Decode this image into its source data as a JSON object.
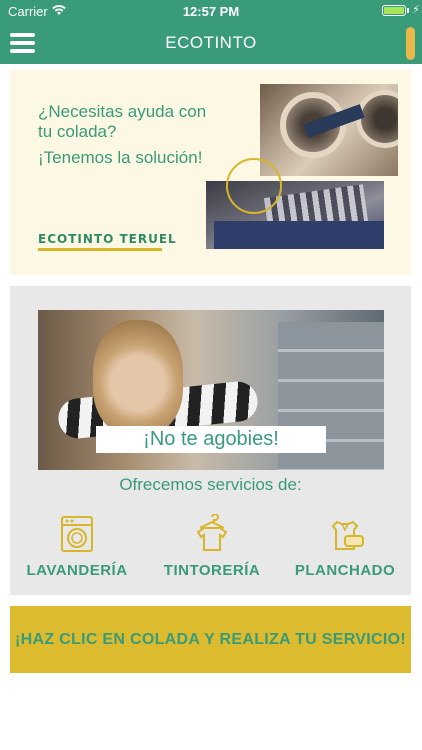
{
  "status_bar": {
    "carrier": "Carrier",
    "time": "12:57 PM",
    "battery_level": 1.0
  },
  "nav": {
    "title": "ECOTINTO",
    "menu_icon": "hamburger-menu-icon",
    "accent": "#e8b94a"
  },
  "hero": {
    "question": "¿Necesitas ayuda con tu colada?",
    "answer": "¡Tenemos la solución!",
    "logo": "ECOTINTO TERUEL"
  },
  "services": {
    "banner": "¡No te agobies!",
    "intro": "Ofrecemos servicios de:",
    "items": [
      {
        "label": "LAVANDERÍA",
        "icon": "washing-machine-icon"
      },
      {
        "label": "TINTORERÍA",
        "icon": "shirt-on-hanger-icon"
      },
      {
        "label": "PLANCHADO",
        "icon": "iron-icon"
      }
    ]
  },
  "cta": {
    "label": "¡HAZ CLIC EN COLADA Y REALIZA TU SERVICIO!"
  },
  "colors": {
    "green": "#3a9b78",
    "gold": "#d8b62a",
    "cream": "#fdf8e3",
    "grey": "#e8e8e8",
    "cta": "#dcbb2e"
  }
}
